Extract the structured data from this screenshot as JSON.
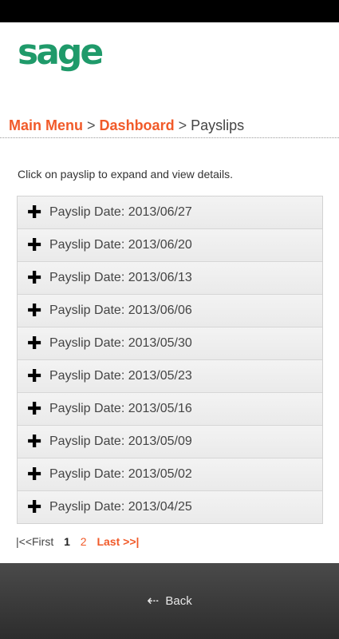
{
  "app": {
    "logo_text": "sage",
    "brand_color": "#1f9a6a",
    "accent_color": "#f15a29"
  },
  "breadcrumb": {
    "main_menu": "Main Menu",
    "separator": ">",
    "dashboard": "Dashboard",
    "current": "Payslips"
  },
  "instructions": "Click on payslip to expand and view details.",
  "payslips": [
    {
      "label": "Payslip Date: 2013/06/27",
      "icon": "plus-icon"
    },
    {
      "label": "Payslip Date: 2013/06/20",
      "icon": "plus-icon"
    },
    {
      "label": "Payslip Date: 2013/06/13",
      "icon": "plus-icon"
    },
    {
      "label": "Payslip Date: 2013/06/06",
      "icon": "plus-icon"
    },
    {
      "label": "Payslip Date: 2013/05/30",
      "icon": "plus-icon"
    },
    {
      "label": "Payslip Date: 2013/05/23",
      "icon": "plus-icon"
    },
    {
      "label": "Payslip Date: 2013/05/16",
      "icon": "plus-icon"
    },
    {
      "label": "Payslip Date: 2013/05/09",
      "icon": "plus-icon"
    },
    {
      "label": "Payslip Date: 2013/05/02",
      "icon": "plus-icon"
    },
    {
      "label": "Payslip Date: 2013/04/25",
      "icon": "plus-icon"
    }
  ],
  "pagination": {
    "first": "|<<First",
    "pages": [
      "1",
      "2"
    ],
    "current_page": "1",
    "last": "Last >>|"
  },
  "footer": {
    "back_label": "Back",
    "back_icon": "back-arrow-icon"
  }
}
